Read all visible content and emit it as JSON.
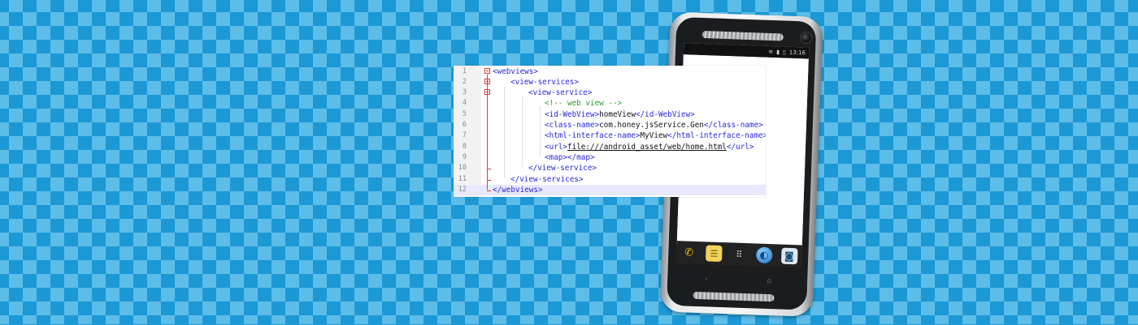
{
  "code": {
    "lines": [
      {
        "no": "1",
        "indent": 0,
        "open": "<webviews>",
        "text": "",
        "close": ""
      },
      {
        "no": "2",
        "indent": 1,
        "open": "<view-services>",
        "text": "",
        "close": ""
      },
      {
        "no": "3",
        "indent": 2,
        "open": "<view-service>",
        "text": "",
        "close": ""
      },
      {
        "no": "4",
        "indent": 3,
        "comment": "<!-- web view -->"
      },
      {
        "no": "5",
        "indent": 3,
        "open": "<id-WebView>",
        "text": "homeView",
        "close": "</id-WebView>"
      },
      {
        "no": "6",
        "indent": 3,
        "open": "<class-name>",
        "text": "com.honey.jsService.Gen",
        "close": "</class-name>"
      },
      {
        "no": "7",
        "indent": 3,
        "open": "<html-interface-name>",
        "text": "MyView",
        "close": "</html-interface-name>"
      },
      {
        "no": "8",
        "indent": 3,
        "open": "<url>",
        "text": "file:///android_asset/web/home.html",
        "close": "</url>"
      },
      {
        "no": "9",
        "indent": 3,
        "open": "<map>",
        "text": "",
        "close": "</map>"
      },
      {
        "no": "10",
        "indent": 2,
        "open": "",
        "text": "",
        "close": "</view-service>"
      },
      {
        "no": "11",
        "indent": 1,
        "open": "",
        "text": "",
        "close": "</view-services>"
      },
      {
        "no": "12",
        "indent": 0,
        "open": "",
        "text": "",
        "close": "</webviews>"
      }
    ]
  },
  "phone": {
    "status_time": "13:16",
    "status_icons": [
      "wifi-icon",
      "signal-icon",
      "battery-icon"
    ],
    "dock_icons": [
      "phone-icon",
      "messages-icon",
      "apps-grid-icon",
      "browser-globe-icon",
      "camera-icon"
    ],
    "nav_icons": [
      "back-icon",
      "home-icon"
    ]
  },
  "colors": {
    "checker_dark": "#1c98d5",
    "checker_light": "#5dbde9",
    "xml_tag": "#2727e0",
    "xml_comment": "#2a9d2a",
    "fold_marker": "#e03a3a"
  }
}
